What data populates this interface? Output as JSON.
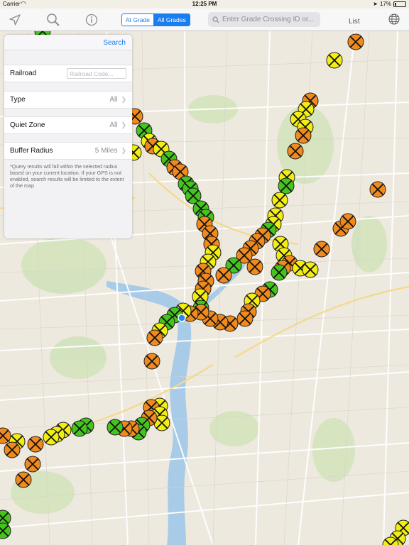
{
  "status_bar": {
    "carrier": "Carrier",
    "time": "12:25 PM",
    "battery_text": "17%",
    "battery_level": 0.17
  },
  "toolbar": {
    "icons": [
      "location-arrow-icon",
      "search-icon",
      "info-icon"
    ],
    "segment_at_grade": "At Grade",
    "segment_all_grades": "All Grades",
    "selected_segment": "All Grades",
    "search_placeholder": "Enter Grade Crossing ID or...",
    "list_label": "List",
    "globe_icon": "globe-icon"
  },
  "panel": {
    "search_label": "Search",
    "railroad_label": "Railroad",
    "railroad_placeholder": "Railroad Code...",
    "type_label": "Type",
    "type_value": "All",
    "quiet_zone_label": "Quiet Zone",
    "quiet_zone_value": "All",
    "buffer_radius_label": "Buffer Radius",
    "buffer_radius_value": "5 Miles",
    "note": "*Query results will fall within the selected radius based on your current location. If your GPS is not enabled, search results will be limited to the extent of the map"
  },
  "map": {
    "marker_colors": {
      "green": "#45c41e",
      "yellow": "#f2ee12",
      "orange": "#f08a1d"
    },
    "marker_icon": "railroad-crossing-icon",
    "location_icon": "current-location-icon"
  }
}
